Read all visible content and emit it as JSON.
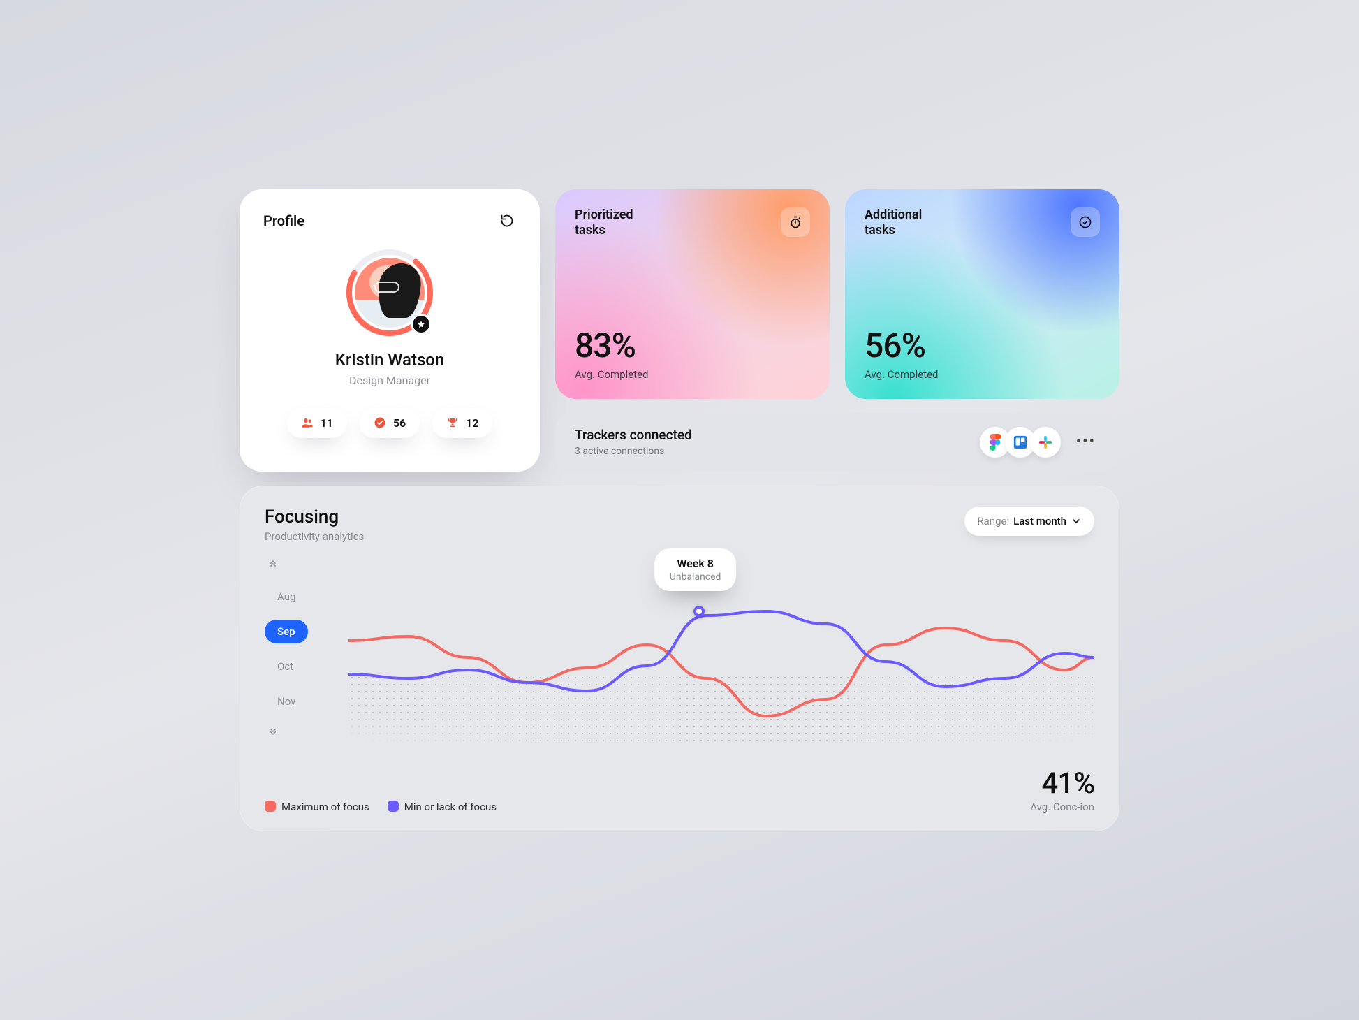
{
  "profile": {
    "heading": "Profile",
    "name": "Kristin Watson",
    "role": "Design Manager",
    "progress_pct": 72,
    "stats": {
      "team": "11",
      "checks": "56",
      "trophies": "12"
    }
  },
  "cards": {
    "prioritized": {
      "title_l1": "Prioritized",
      "title_l2": "tasks",
      "value": "83%",
      "sub": "Avg. Completed"
    },
    "additional": {
      "title_l1": "Additional",
      "title_l2": "tasks",
      "value": "56%",
      "sub": "Avg. Completed"
    }
  },
  "trackers": {
    "title": "Trackers connected",
    "sub": "3 active connections",
    "apps": [
      "figma",
      "trello",
      "slack"
    ]
  },
  "focusing": {
    "title": "Focusing",
    "subtitle": "Productivity analytics",
    "range_label": "Range:",
    "range_value": "Last month",
    "months": [
      "Aug",
      "Sep",
      "Oct",
      "Nov"
    ],
    "active_month": "Sep",
    "tooltip": {
      "week": "Week 8",
      "status": "Unbalanced"
    },
    "legend": {
      "max": "Maximum of focus",
      "min": "Min or lack of focus"
    },
    "concentration": {
      "value": "41%",
      "label": "Avg. Conc-ion"
    }
  },
  "chart_data": {
    "type": "line",
    "xlabel": "",
    "ylabel": "",
    "x_range": [
      0,
      100
    ],
    "y_range": [
      0,
      100
    ],
    "series": [
      {
        "name": "Maximum of focus",
        "color": "#f46a62",
        "x": [
          0,
          8,
          16,
          24,
          32,
          40,
          48,
          56,
          64,
          72,
          80,
          88,
          96,
          100
        ],
        "values": [
          58,
          60,
          50,
          38,
          45,
          56,
          40,
          22,
          30,
          56,
          64,
          58,
          44,
          50
        ]
      },
      {
        "name": "Min or lack of focus",
        "color": "#6b5bff",
        "x": [
          0,
          8,
          16,
          24,
          32,
          40,
          48,
          56,
          64,
          72,
          80,
          88,
          96,
          100
        ],
        "values": [
          42,
          40,
          44,
          38,
          34,
          46,
          70,
          72,
          66,
          48,
          36,
          40,
          52,
          50
        ]
      }
    ],
    "highlight": {
      "series": "Min or lack of focus",
      "x": 48,
      "value": 70,
      "label": "Week 8",
      "status": "Unbalanced"
    }
  }
}
